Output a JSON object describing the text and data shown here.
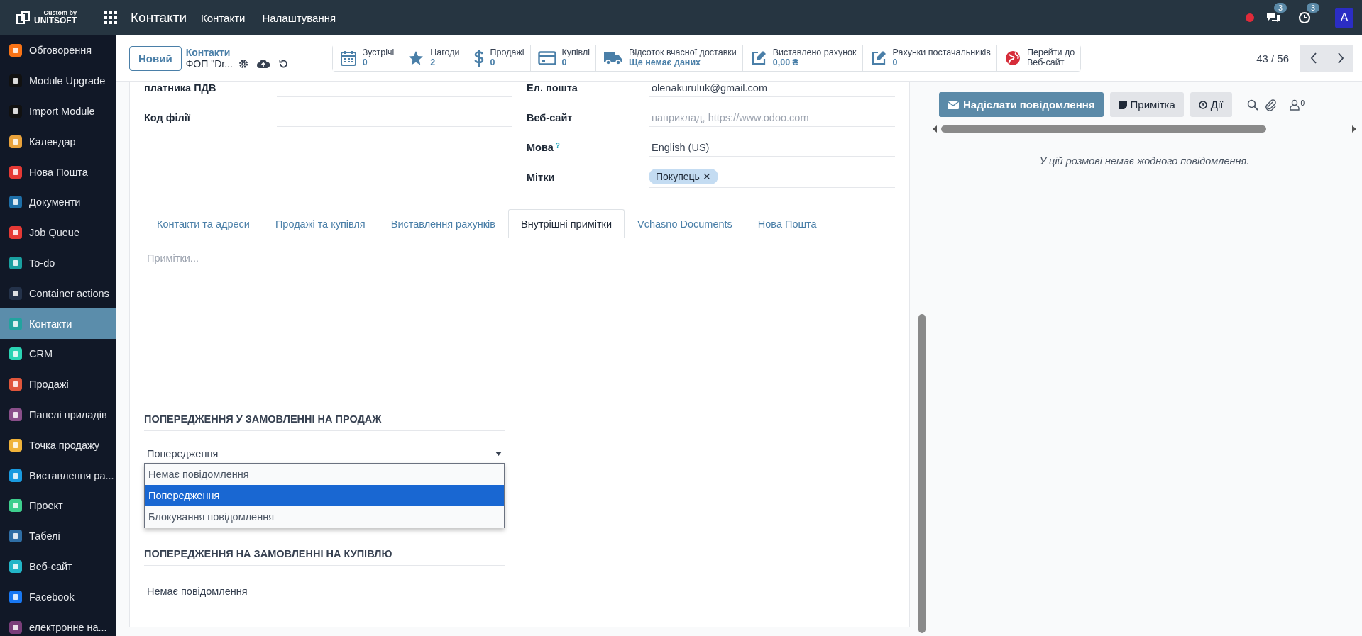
{
  "navbar": {
    "brand_top": "Custom by",
    "brand": "UNITSOFT",
    "app": "Контакти",
    "menus": [
      "Контакти",
      "Налаштування"
    ],
    "chat_count": "3",
    "activity_count": "3",
    "avatar": "A"
  },
  "sidebar": {
    "items": [
      {
        "label": "Обговорення",
        "selected": false
      },
      {
        "label": "Module Upgrade",
        "selected": false
      },
      {
        "label": "Import Module",
        "selected": false
      },
      {
        "label": "Календар",
        "selected": false
      },
      {
        "label": "Нова Пошта",
        "selected": false
      },
      {
        "label": "Документи",
        "selected": false
      },
      {
        "label": "Job Queue",
        "selected": false
      },
      {
        "label": "To-do",
        "selected": false
      },
      {
        "label": "Container actions",
        "selected": false
      },
      {
        "label": "Контакти",
        "selected": true
      },
      {
        "label": "CRM",
        "selected": false
      },
      {
        "label": "Продажі",
        "selected": false
      },
      {
        "label": "Панелі приладів",
        "selected": false
      },
      {
        "label": "Точка продажу",
        "selected": false
      },
      {
        "label": "Виставлення ра...",
        "selected": false
      },
      {
        "label": "Проект",
        "selected": false
      },
      {
        "label": "Табелі",
        "selected": false
      },
      {
        "label": "Веб-сайт",
        "selected": false
      },
      {
        "label": "Facebook",
        "selected": false
      },
      {
        "label": "електронне на...",
        "selected": false
      }
    ]
  },
  "control_panel": {
    "new_button": "Новий",
    "breadcrumb": "Контакти",
    "record": "ФОП \"Dr...",
    "pager": "43 / 56",
    "stats": [
      {
        "label": "Зустрічі",
        "value": "0",
        "kind": "calendar"
      },
      {
        "label": "Нагоди",
        "value": "2",
        "kind": "star"
      },
      {
        "label": "Продажі",
        "value": "0",
        "kind": "dollar"
      },
      {
        "label": "Купівлі",
        "value": "0",
        "kind": "card"
      },
      {
        "label": "Відсоток вчасної доставки",
        "value": "Ще немає даних",
        "kind": "truck"
      },
      {
        "label": "Виставлено рахунок",
        "value": "0,00 ₴",
        "kind": "edit"
      },
      {
        "label": "Рахунки постачальників",
        "value": "0",
        "kind": "edit"
      },
      {
        "label": "Перейти до",
        "value": "Веб-сайт",
        "kind": "globe"
      }
    ]
  },
  "form": {
    "left_fields": [
      {
        "label": "платника ПДВ"
      },
      {
        "label": "Код філії"
      }
    ],
    "email": {
      "label": "Ел. пошта",
      "value": "olenakuruluk@gmail.com"
    },
    "website": {
      "label": "Веб-сайт",
      "placeholder": "наприклад, https://www.odoo.com"
    },
    "language": {
      "label": "Мова",
      "help": "?",
      "value": "English (US)"
    },
    "tags": {
      "label": "Мітки",
      "items": [
        "Покупець"
      ],
      "remove": "✕"
    },
    "tabs": [
      {
        "label": "Контакти та адреси",
        "selected": false
      },
      {
        "label": "Продажі та купівля",
        "selected": false
      },
      {
        "label": "Виставлення рахунків",
        "selected": false
      },
      {
        "label": "Внутрішні примітки",
        "selected": true
      },
      {
        "label": "Vchasno Documents",
        "selected": false
      },
      {
        "label": "Нова Пошта",
        "selected": false
      }
    ],
    "notes_placeholder": "Примітки...",
    "sale_warning": {
      "heading": "ПОПЕРЕДЖЕННЯ У ЗАМОВЛЕННІ НА ПРОДАЖ",
      "value": "Попередження",
      "expanded": true,
      "options": [
        {
          "label": "Немає повідомлення",
          "selected": false
        },
        {
          "label": "Попередження",
          "selected": true
        },
        {
          "label": "Блокування повідомлення",
          "selected": false
        }
      ]
    },
    "purchase_warning": {
      "heading": "ПОПЕРЕДЖЕННЯ НА ЗАМОВЛЕННІ НА КУПІВЛЮ",
      "value": "Немає повідомлення"
    }
  },
  "chatter": {
    "send_button": "Надіслати повідомлення",
    "note_button": "Примітка",
    "activity_button": "Дії",
    "followers": "0",
    "empty": "У цій розмові немає жодного повідомлення."
  }
}
